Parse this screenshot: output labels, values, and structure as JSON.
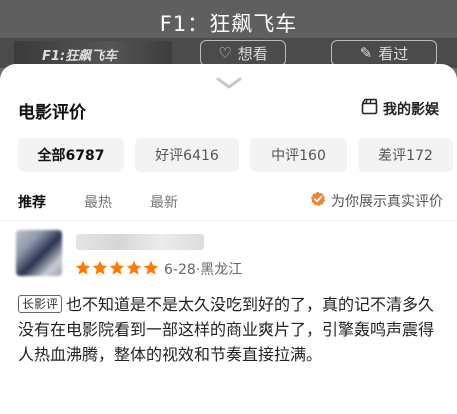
{
  "header": {
    "movie_title": "F1：狂飙飞车"
  },
  "poster": {
    "caption": "F1:狂飙飞车"
  },
  "actions": {
    "want_label": "想看",
    "seen_label": "看过"
  },
  "panel": {
    "title": "电影评价",
    "my_link": "我的影娱"
  },
  "filters": [
    {
      "label": "全部6787",
      "active": true
    },
    {
      "label": "好评6416",
      "active": false
    },
    {
      "label": "中评160",
      "active": false
    },
    {
      "label": "差评172",
      "active": false
    }
  ],
  "tabs": [
    {
      "label": "推荐",
      "active": true
    },
    {
      "label": "最热",
      "active": false
    },
    {
      "label": "最新",
      "active": false
    }
  ],
  "true_review_label": "为你展示真实评价",
  "review": {
    "stars": 5,
    "date_location": "6-28·黑龙江",
    "tag": "长影评",
    "text": "也不知道是不是太久没吃到好的了，真的记不清多久没有在电影院看到一部这样的商业爽片了，引擎轰鸣声震得人热血沸腾，整体的视效和节奏直接拉满。"
  },
  "colors": {
    "star": "#ff7a00",
    "badge_icon": "#e8863a"
  }
}
